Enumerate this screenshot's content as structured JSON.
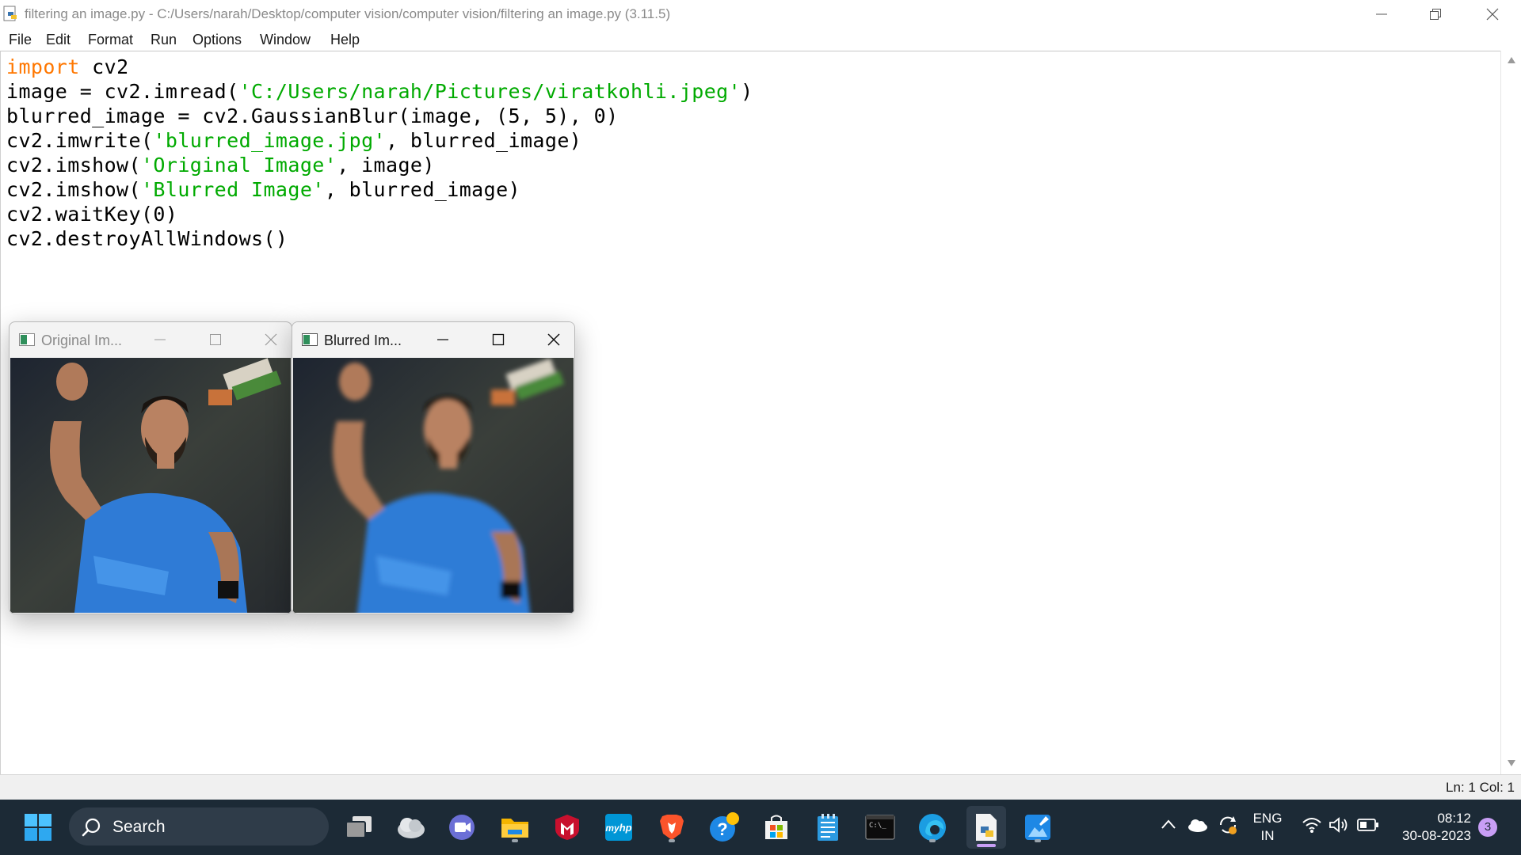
{
  "window": {
    "title": "filtering an image.py - C:/Users/narah/Desktop/computer vision/computer vision/filtering an image.py (3.11.5)"
  },
  "menu": [
    "File",
    "Edit",
    "Format",
    "Run",
    "Options",
    "Window",
    "Help"
  ],
  "code": {
    "line1": {
      "kw": "import",
      "rest": " cv2"
    },
    "line2": {
      "pre": "image = cv2.imread(",
      "str": "'C:/Users/narah/Pictures/viratkohli.jpeg'",
      "post": ")"
    },
    "line3": {
      "text": "blurred_image = cv2.GaussianBlur(image, (5, 5), 0)"
    },
    "line4": {
      "pre": "cv2.imwrite(",
      "str": "'blurred_image.jpg'",
      "post": ", blurred_image)"
    },
    "line5": {
      "pre": "cv2.imshow(",
      "str": "'Original Image'",
      "post": ", image)"
    },
    "line6": {
      "pre": "cv2.imshow(",
      "str": "'Blurred Image'",
      "post": ", blurred_image)"
    },
    "line7": {
      "text": "cv2.waitKey(0)"
    },
    "line8": {
      "text": "cv2.destroyAllWindows()"
    }
  },
  "colors": {
    "keyword": "#ff7700",
    "string": "#00aa00",
    "taskbar": "#1c2a36"
  },
  "windows": {
    "original": {
      "title": "Original Im...",
      "active": false
    },
    "blurred": {
      "title": "Blurred Im...",
      "active": true
    }
  },
  "status": {
    "text": "Ln: 1   Col: 1"
  },
  "taskbar": {
    "search_label": "Search",
    "apps": [
      "start-icon",
      "task-view-icon",
      "weather-icon",
      "teams-chat-icon",
      "file-explorer-icon",
      "mcafee-icon",
      "myhp-icon",
      "brave-icon",
      "help-icon",
      "ms-store-icon",
      "notepad-icon",
      "terminal-icon",
      "edge-icon",
      "idle-icon",
      "paint-icon"
    ]
  },
  "tray": {
    "lang1": "ENG",
    "lang2": "IN",
    "time": "08:12",
    "date": "30-08-2023",
    "notification_count": "3"
  }
}
